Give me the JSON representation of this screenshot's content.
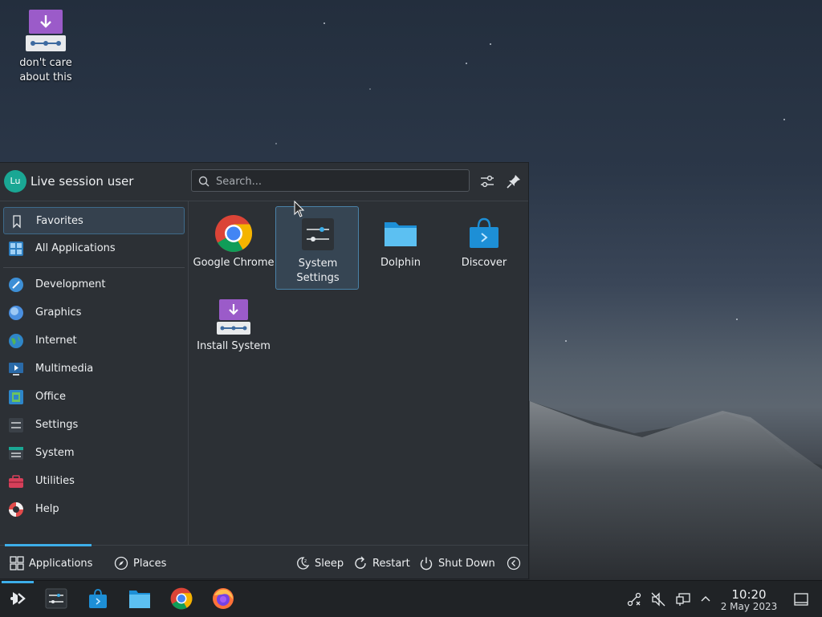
{
  "desktop": {
    "icon_label": "don't care about this"
  },
  "launcher": {
    "user_name": "Live session user",
    "avatar_initials": "Lu",
    "search": {
      "placeholder": "Search..."
    },
    "sidebar": {
      "favorites": "Favorites",
      "all_applications": "All Applications",
      "categories": [
        "Development",
        "Graphics",
        "Internet",
        "Multimedia",
        "Office",
        "Settings",
        "System",
        "Utilities",
        "Help"
      ]
    },
    "apps": [
      {
        "label": "Google Chrome",
        "icon": "chrome-icon"
      },
      {
        "label": "System Settings",
        "icon": "system-settings-icon",
        "selected": true
      },
      {
        "label": "Dolphin",
        "icon": "dolphin-folder-icon"
      },
      {
        "label": "Discover",
        "icon": "discover-bag-icon"
      },
      {
        "label": "Install System",
        "icon": "install-system-icon"
      }
    ],
    "footer": {
      "applications": "Applications",
      "places": "Places",
      "sleep": "Sleep",
      "restart": "Restart",
      "shutdown": "Shut Down"
    }
  },
  "taskbar": {
    "pinned": [
      "kde-launcher-icon",
      "system-settings-icon",
      "discover-icon",
      "dolphin-icon",
      "chrome-icon",
      "firefox-icon"
    ],
    "tray": [
      "network-icon",
      "volume-muted-icon",
      "display-icon",
      "expand-tray-icon"
    ],
    "clock": {
      "time": "10:20",
      "date": "2 May 2023"
    }
  },
  "colors": {
    "accent": "#3daee9",
    "panel": "#2c3035",
    "taskbar": "#202326"
  }
}
